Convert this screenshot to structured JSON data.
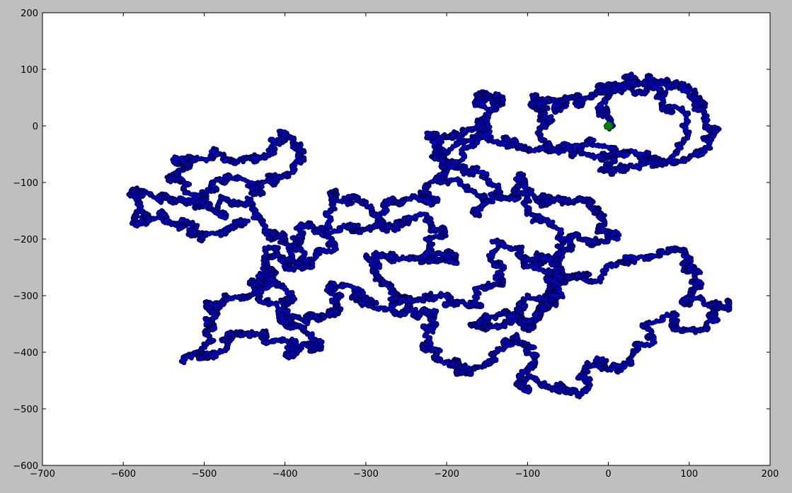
{
  "chart_data": {
    "type": "scatter",
    "title": "",
    "xlabel": "",
    "ylabel": "",
    "xlim": [
      -700,
      200
    ],
    "ylim": [
      -600,
      200
    ],
    "x_ticks": [
      -700,
      -600,
      -500,
      -400,
      -300,
      -200,
      -100,
      0,
      100,
      200
    ],
    "y_ticks": [
      200,
      100,
      0,
      -100,
      -200,
      -300,
      -400,
      -500,
      -600
    ],
    "x_tick_labels": [
      "−700",
      "−600",
      "−500",
      "−400",
      "−300",
      "−200",
      "−100",
      "0",
      "100",
      "200"
    ],
    "y_tick_labels": [
      "200",
      "100",
      "0",
      "−100",
      "−200",
      "−300",
      "−400",
      "−500",
      "−600"
    ],
    "grid": false,
    "colors": {
      "walk_fill": "#0000ff",
      "walk_edge": "#000000",
      "origin_fill": "#008000",
      "axes_background": "#ffffff",
      "figure_background": "#bfbfbf"
    },
    "series": [
      {
        "kind": "random-walk",
        "marker": "circle",
        "points_count": 20000,
        "waypoints": [
          [
            0,
            0
          ],
          [
            10,
            40
          ],
          [
            20,
            85
          ],
          [
            60,
            70
          ],
          [
            100,
            70
          ],
          [
            115,
            50
          ],
          [
            130,
            -30
          ],
          [
            90,
            -60
          ],
          [
            40,
            -60
          ],
          [
            -20,
            -40
          ],
          [
            -60,
            -30
          ],
          [
            -90,
            0
          ],
          [
            -110,
            40
          ],
          [
            -80,
            50
          ],
          [
            -50,
            40
          ],
          [
            -30,
            60
          ],
          [
            -10,
            80
          ],
          [
            20,
            90
          ],
          [
            60,
            80
          ],
          [
            90,
            20
          ],
          [
            60,
            -80
          ],
          [
            10,
            -80
          ],
          [
            -40,
            -60
          ],
          [
            -90,
            -50
          ],
          [
            -140,
            -30
          ],
          [
            -180,
            -10
          ],
          [
            -220,
            -60
          ],
          [
            -200,
            -120
          ],
          [
            -160,
            -150
          ],
          [
            -110,
            -90
          ],
          [
            -80,
            -150
          ],
          [
            -40,
            -140
          ],
          [
            10,
            -150
          ],
          [
            -10,
            -200
          ],
          [
            -60,
            -210
          ],
          [
            -100,
            -240
          ],
          [
            -60,
            -280
          ],
          [
            -20,
            -250
          ],
          [
            30,
            -240
          ],
          [
            90,
            -240
          ],
          [
            120,
            -270
          ],
          [
            100,
            -320
          ],
          [
            140,
            -320
          ],
          [
            110,
            -360
          ],
          [
            60,
            -350
          ],
          [
            30,
            -400
          ],
          [
            -10,
            -450
          ],
          [
            -40,
            -460
          ],
          [
            -70,
            -490
          ],
          [
            -110,
            -460
          ],
          [
            -90,
            -400
          ],
          [
            -130,
            -380
          ],
          [
            -150,
            -440
          ],
          [
            -190,
            -400
          ],
          [
            -240,
            -380
          ],
          [
            -220,
            -330
          ],
          [
            -260,
            -320
          ],
          [
            -300,
            -310
          ],
          [
            -330,
            -280
          ],
          [
            -360,
            -300
          ],
          [
            -350,
            -350
          ],
          [
            -390,
            -360
          ],
          [
            -420,
            -330
          ],
          [
            -400,
            -280
          ],
          [
            -430,
            -240
          ],
          [
            -460,
            -300
          ],
          [
            -500,
            -320
          ],
          [
            -490,
            -370
          ],
          [
            -520,
            -410
          ],
          [
            -470,
            -400
          ],
          [
            -440,
            -380
          ],
          [
            -410,
            -380
          ],
          [
            -380,
            -410
          ],
          [
            -360,
            -380
          ],
          [
            -400,
            -330
          ],
          [
            -440,
            -290
          ],
          [
            -430,
            -220
          ],
          [
            -390,
            -250
          ],
          [
            -370,
            -200
          ],
          [
            -350,
            -160
          ],
          [
            -340,
            -110
          ],
          [
            -300,
            -130
          ],
          [
            -270,
            -180
          ],
          [
            -230,
            -170
          ],
          [
            -180,
            -200
          ],
          [
            -200,
            -250
          ],
          [
            -240,
            -240
          ],
          [
            -280,
            -230
          ],
          [
            -300,
            -280
          ],
          [
            -260,
            -300
          ],
          [
            -210,
            -290
          ],
          [
            -170,
            -300
          ],
          [
            -150,
            -260
          ],
          [
            -120,
            -200
          ],
          [
            -80,
            -230
          ],
          [
            -50,
            -270
          ],
          [
            -90,
            -310
          ],
          [
            -120,
            -330
          ],
          [
            -150,
            -340
          ],
          [
            -180,
            -360
          ],
          [
            -140,
            -360
          ],
          [
            -100,
            -350
          ],
          [
            -60,
            -330
          ],
          [
            -30,
            -300
          ],
          [
            -60,
            -180
          ],
          [
            -100,
            -130
          ],
          [
            -150,
            -100
          ],
          [
            -190,
            -60
          ],
          [
            -210,
            -30
          ],
          [
            -170,
            0
          ],
          [
            -130,
            30
          ],
          [
            -150,
            50
          ],
          [
            -180,
            40
          ],
          [
            -160,
            -50
          ],
          [
            -200,
            -90
          ],
          [
            -250,
            -140
          ],
          [
            -300,
            -150
          ],
          [
            -330,
            -190
          ],
          [
            -360,
            -230
          ],
          [
            -390,
            -250
          ],
          [
            -420,
            -200
          ],
          [
            -450,
            -140
          ],
          [
            -480,
            -160
          ],
          [
            -520,
            -130
          ],
          [
            -540,
            -90
          ],
          [
            -500,
            -50
          ],
          [
            -470,
            -30
          ],
          [
            -430,
            -60
          ],
          [
            -400,
            -10
          ],
          [
            -380,
            -70
          ],
          [
            -410,
            -110
          ],
          [
            -450,
            -110
          ],
          [
            -490,
            -100
          ],
          [
            -530,
            -150
          ],
          [
            -570,
            -140
          ],
          [
            -600,
            -110
          ],
          [
            -590,
            -170
          ],
          [
            -550,
            -150
          ],
          [
            -520,
            -180
          ],
          [
            -480,
            -190
          ],
          [
            -440,
            -170
          ]
        ]
      },
      {
        "kind": "origin-marker",
        "marker": "circle",
        "points": [
          [
            0,
            0
          ]
        ]
      }
    ]
  }
}
